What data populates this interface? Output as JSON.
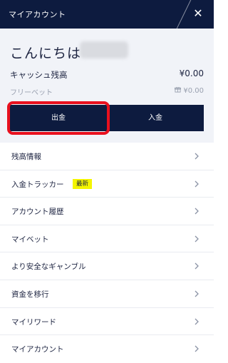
{
  "header": {
    "title": "マイアカウント",
    "close_icon": "close-icon",
    "background_color": "#0d1b3f"
  },
  "account": {
    "greeting": "こんにちは",
    "cash_balance_label": "キャッシュ残高",
    "cash_balance_value": "¥0.00",
    "free_bet_label": "フリーベット",
    "free_bet_value": "¥0.00",
    "free_bet_icon": "gift-icon"
  },
  "actions": {
    "withdraw_label": "出金",
    "deposit_label": "入金",
    "highlight_color": "#e8101e"
  },
  "menu": {
    "items": [
      {
        "label": "残高情報"
      },
      {
        "label": "入金トラッカー",
        "badge": "最新"
      },
      {
        "label": "アカウント履歴"
      },
      {
        "label": "マイベット"
      },
      {
        "label": "より安全なギャンブル"
      },
      {
        "label": "資金を移行"
      },
      {
        "label": "マイリワード"
      },
      {
        "label": "マイアカウント"
      }
    ],
    "chevron_icon": "chevron-right-icon",
    "badge_color": "#f4f500"
  }
}
